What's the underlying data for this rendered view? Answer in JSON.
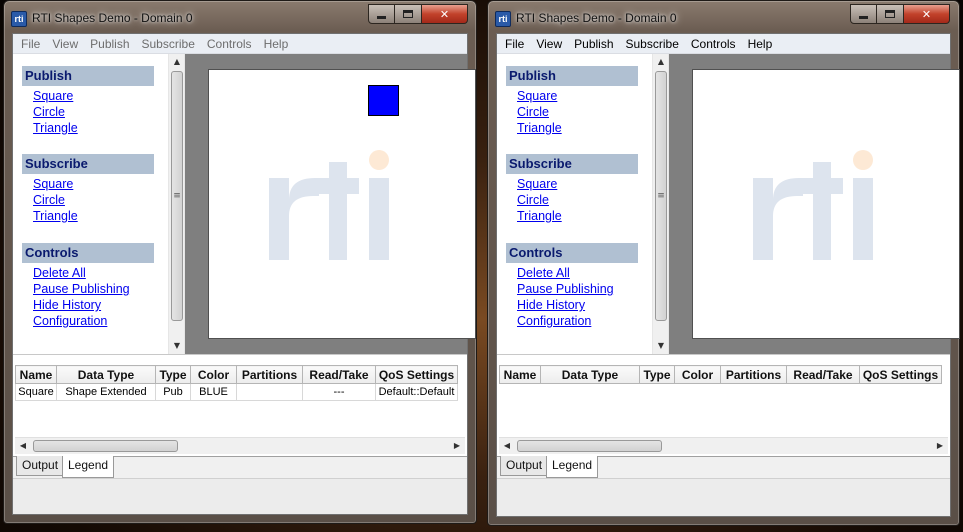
{
  "windows": [
    {
      "title": "RTI Shapes Demo - Domain 0",
      "app_icon_text": "rti",
      "menu": [
        "File",
        "View",
        "Publish",
        "Subscribe",
        "Controls",
        "Help"
      ],
      "sections": {
        "publish": {
          "title": "Publish",
          "links": [
            "Square",
            "Circle",
            "Triangle"
          ]
        },
        "subscribe": {
          "title": "Subscribe",
          "links": [
            "Square",
            "Circle",
            "Triangle"
          ]
        },
        "controls": {
          "title": "Controls",
          "links": [
            "Delete All",
            "Pause Publishing",
            "Hide History",
            "Configuration"
          ]
        }
      },
      "canvas_shapes": [
        {
          "type": "square",
          "color": "#0000ff"
        }
      ],
      "table": {
        "columns": [
          "Name",
          "Data Type",
          "Type",
          "Color",
          "Partitions",
          "Read/Take",
          "QoS Settings"
        ],
        "rows": [
          [
            "Square",
            "Shape Extended",
            "Pub",
            "BLUE",
            "",
            "---",
            "Default::Default"
          ]
        ]
      },
      "tabs": [
        "Output",
        "Legend"
      ],
      "selected_tab": "Legend"
    },
    {
      "title": "RTI Shapes Demo - Domain 0",
      "app_icon_text": "rti",
      "menu": [
        "File",
        "View",
        "Publish",
        "Subscribe",
        "Controls",
        "Help"
      ],
      "sections": {
        "publish": {
          "title": "Publish",
          "links": [
            "Square",
            "Circle",
            "Triangle"
          ]
        },
        "subscribe": {
          "title": "Subscribe",
          "links": [
            "Square",
            "Circle",
            "Triangle"
          ]
        },
        "controls": {
          "title": "Controls",
          "links": [
            "Delete All",
            "Pause Publishing",
            "Hide History",
            "Configuration"
          ]
        }
      },
      "canvas_shapes": [],
      "table": {
        "columns": [
          "Name",
          "Data Type",
          "Type",
          "Color",
          "Partitions",
          "Read/Take",
          "QoS Settings"
        ],
        "rows": []
      },
      "tabs": [
        "Output",
        "Legend"
      ],
      "selected_tab": "Legend"
    }
  ],
  "colors": {
    "section_header_bg": "#b0c0d2",
    "section_header_text": "#0a1a6e",
    "link": "#0000ee",
    "logo_letters": "#dde4ee",
    "logo_dot": "#fde9d5",
    "published_square": "#0000ff"
  }
}
